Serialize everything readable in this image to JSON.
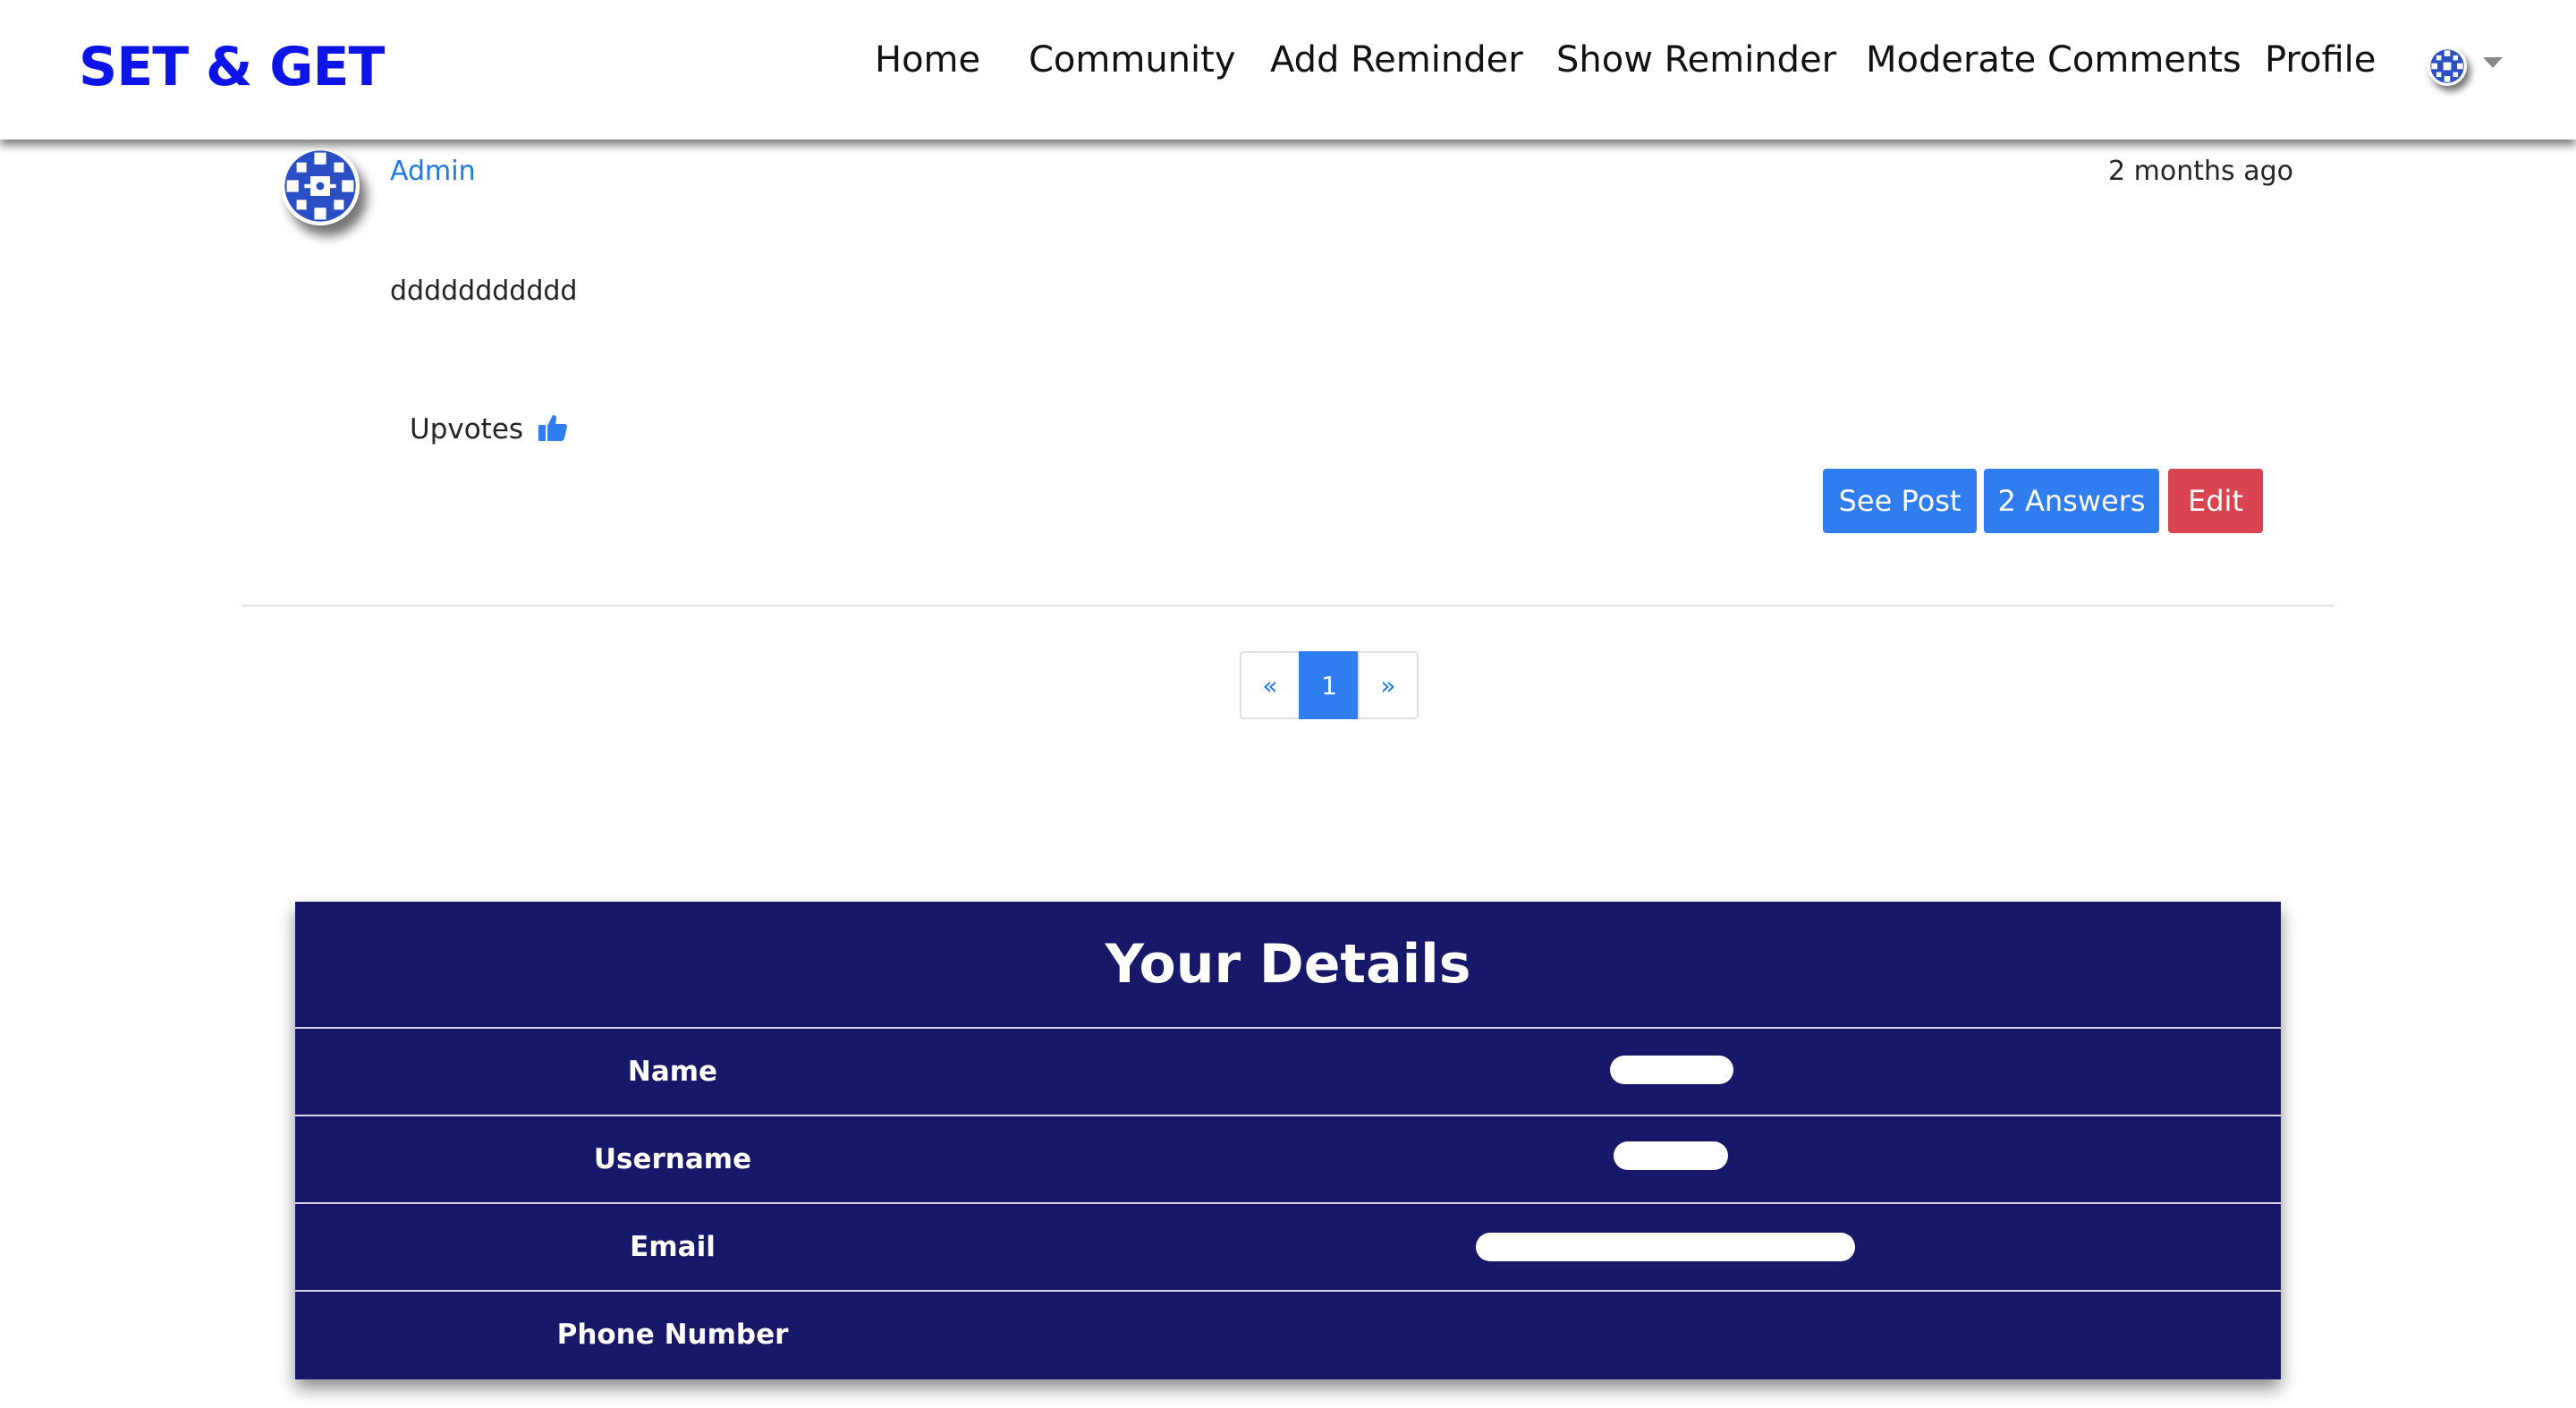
{
  "navbar": {
    "brand": "SET & GET",
    "links": [
      "Home",
      "Community",
      "Add Reminder",
      "Show Reminder",
      "Moderate Comments",
      "Profile"
    ]
  },
  "post": {
    "author": "Admin",
    "time": "2 months ago",
    "body": "ddddddddddd",
    "upvotes_label": "Upvotes",
    "buttons": {
      "see_post": "See Post",
      "answers": "2 Answers",
      "edit": "Edit"
    }
  },
  "pagination": {
    "prev": "«",
    "current": "1",
    "next": "»"
  },
  "details": {
    "title": "Your Details",
    "rows": [
      {
        "label": "Name",
        "value_redacted": true
      },
      {
        "label": "Username",
        "value_redacted": true
      },
      {
        "label": "Email",
        "value_redacted": true
      },
      {
        "label": "Phone Number",
        "value_redacted": false
      }
    ]
  },
  "colors": {
    "brand": "#0d14e8",
    "link": "#1f78e8",
    "primary": "#2f7df0",
    "danger": "#d84450",
    "details_bg": "#18186a"
  },
  "icons": {
    "avatar": "avatar-pattern-icon",
    "upvote": "thumbs-up-icon",
    "dropdown": "caret-down-icon"
  }
}
